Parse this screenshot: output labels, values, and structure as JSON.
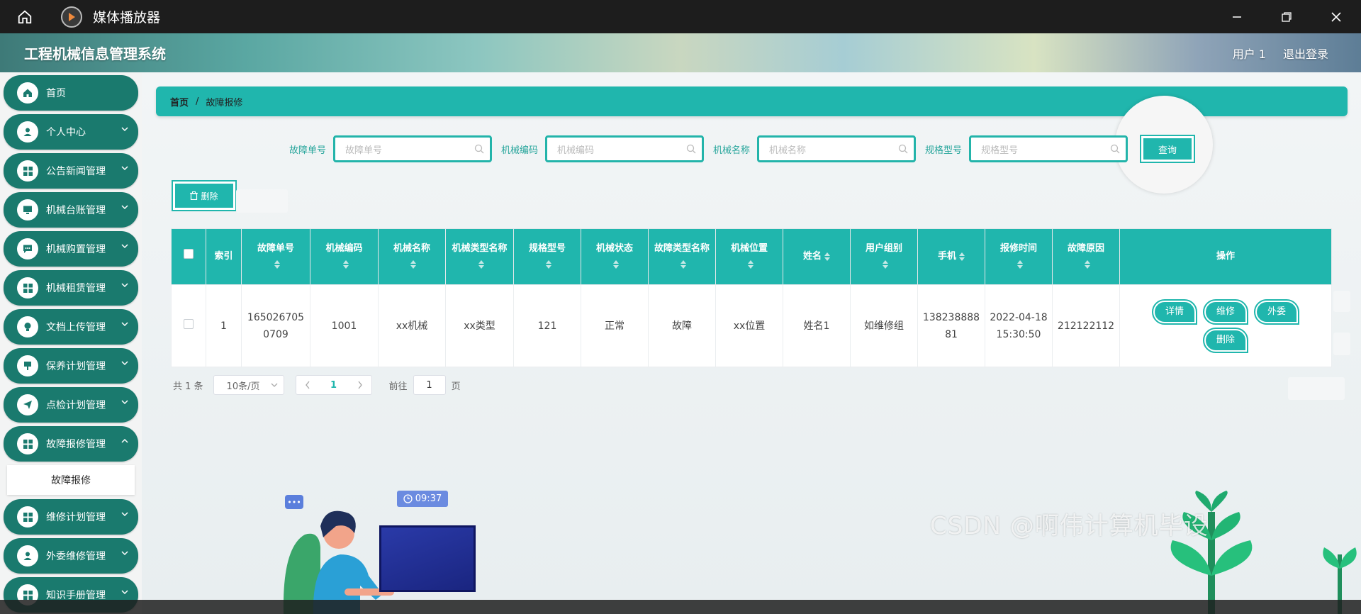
{
  "player": {
    "title": "媒体播放器"
  },
  "header": {
    "title": "工程机械信息管理系统",
    "user": "用户 1",
    "logout": "退出登录"
  },
  "sidebar": {
    "items": [
      {
        "label": "首页",
        "icon": "home-icon"
      },
      {
        "label": "个人中心",
        "icon": "user-icon"
      },
      {
        "label": "公告新闻管理",
        "icon": "grid-icon"
      },
      {
        "label": "机械台账管理",
        "icon": "monitor-icon"
      },
      {
        "label": "机械购置管理",
        "icon": "chat-icon"
      },
      {
        "label": "机械租赁管理",
        "icon": "grid-icon"
      },
      {
        "label": "文档上传管理",
        "icon": "bulb-icon"
      },
      {
        "label": "保养计划管理",
        "icon": "pin-icon"
      },
      {
        "label": "点检计划管理",
        "icon": "send-icon"
      },
      {
        "label": "故障报修管理",
        "icon": "grid-icon"
      },
      {
        "label": "维修计划管理",
        "icon": "grid-icon"
      },
      {
        "label": "外委维修管理",
        "icon": "user-icon"
      },
      {
        "label": "知识手册管理",
        "icon": "grid-icon"
      }
    ],
    "submenu_active": "故障报修"
  },
  "breadcrumb": {
    "home": "首页",
    "separator": "/",
    "current": "故障报修"
  },
  "search": {
    "fields": [
      {
        "label": "故障单号",
        "placeholder": "故障单号"
      },
      {
        "label": "机械编码",
        "placeholder": "机械编码"
      },
      {
        "label": "机械名称",
        "placeholder": "机械名称"
      },
      {
        "label": "规格型号",
        "placeholder": "规格型号"
      }
    ],
    "query_label": "查询"
  },
  "toolbar": {
    "delete_label": "删除"
  },
  "table": {
    "headers": [
      "索引",
      "故障单号",
      "机械编码",
      "机械名称",
      "机械类型名称",
      "规格型号",
      "机械状态",
      "故障类型名称",
      "机械位置",
      "姓名",
      "用户组别",
      "手机",
      "报修时间",
      "故障原因",
      "操作"
    ],
    "rows": [
      {
        "index": "1",
        "fault_no": "1650267050709",
        "machine_code": "1001",
        "machine_name": "xx机械",
        "machine_type": "xx类型",
        "spec": "121",
        "status": "正常",
        "fault_type": "故障",
        "location": "xx位置",
        "name": "姓名1",
        "group": "如维修组",
        "phone": "13823888881",
        "report_time": "2022-04-18 15:30:50",
        "reason": "212122112"
      }
    ],
    "actions": [
      "详情",
      "维修",
      "外委",
      "删除"
    ]
  },
  "pagination": {
    "total": "共 1 条",
    "page_size": "10条/页",
    "current_page": "1",
    "goto_label": "前往",
    "goto_value": "1",
    "page_suffix": "页"
  },
  "illustration": {
    "time": "09:37"
  },
  "watermark": "CSDN @啊伟计算机毕设",
  "colors": {
    "accent": "#20b6ad",
    "sidebar": "#1a7a6e"
  }
}
